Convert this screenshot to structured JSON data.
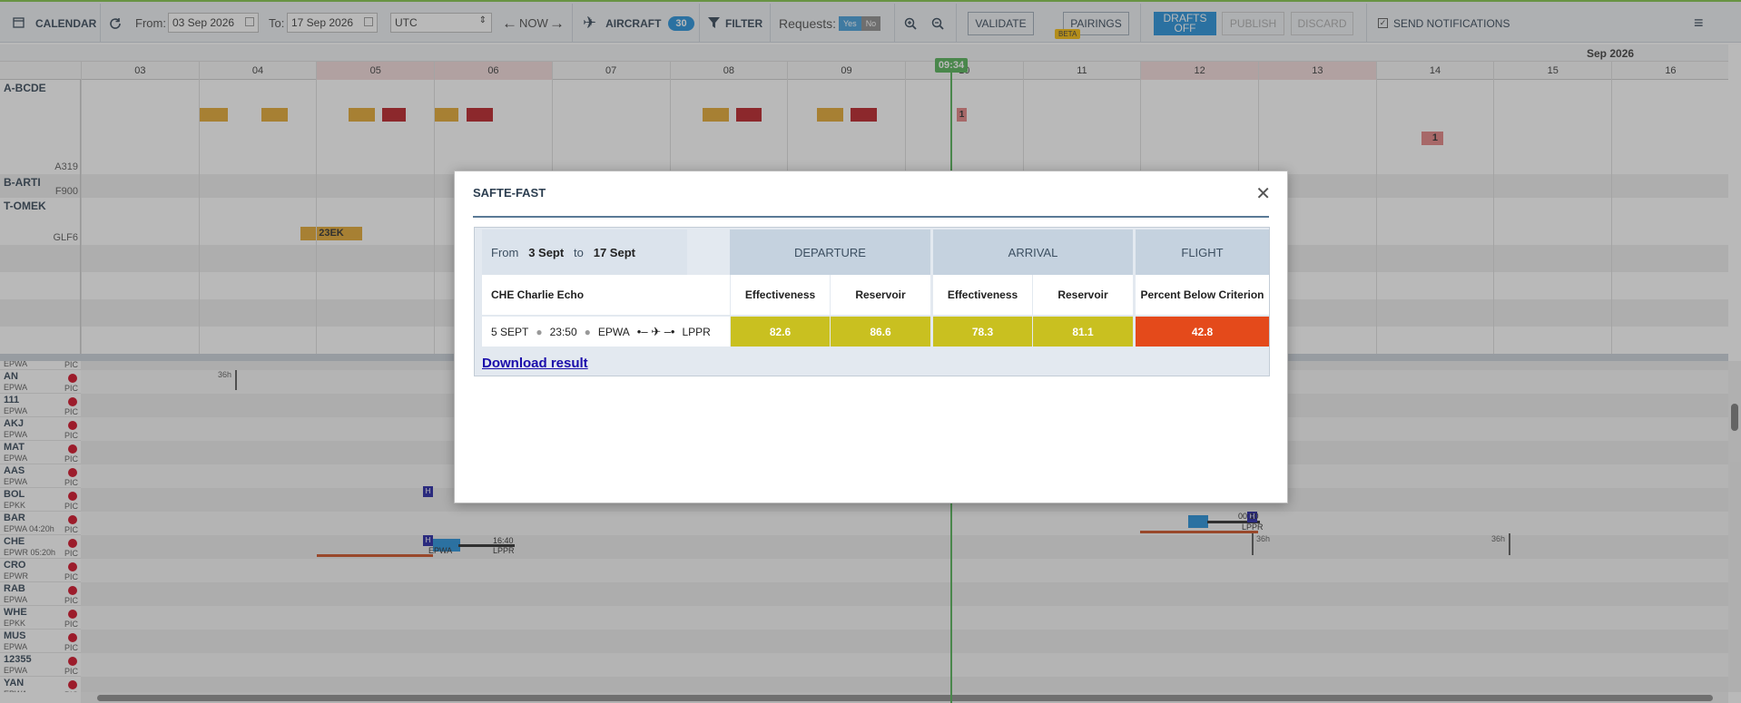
{
  "toolbar": {
    "calendar_label": "CALENDAR",
    "from_label": "From:",
    "from_value": "03 Sep 2026",
    "to_label": "To:",
    "to_value": "17 Sep 2026",
    "timezone": "UTC",
    "now_label": "NOW",
    "aircraft_label": "AIRCRAFT",
    "aircraft_count": "30",
    "filter_label": "FILTER",
    "requests_label": "Requests:",
    "requests_yes": "Yes",
    "requests_no": "No",
    "validate_label": "VALIDATE",
    "pairings_label": "PAIRINGS",
    "beta_label": "BETA",
    "drafts_label_1": "DRAFTS",
    "drafts_label_2": "OFF",
    "publish_label": "PUBLISH",
    "discard_label": "DISCARD",
    "send_notifications_label": "SEND NOTIFICATIONS"
  },
  "timeline": {
    "month_label": "Sep 2026",
    "days": [
      "03",
      "04",
      "05",
      "06",
      "07",
      "08",
      "09",
      "10",
      "11",
      "12",
      "13",
      "14",
      "15",
      "16"
    ],
    "now_time": "09:34"
  },
  "aircraft": [
    {
      "reg": "A-BCDE",
      "type": "A319"
    },
    {
      "reg": "B-ARTI",
      "type": "F900"
    },
    {
      "reg": "T-OMEK",
      "type": "GLF6"
    }
  ],
  "aircraft_blocks": {
    "b1_label": "1",
    "b2_label": "1",
    "b3_label": "23EK"
  },
  "crew": [
    {
      "code": "",
      "base": "EPWA",
      "role": "PIC"
    },
    {
      "code": "AN",
      "base": "EPWA",
      "role": "PIC"
    },
    {
      "code": "111",
      "base": "EPWA",
      "role": "PIC"
    },
    {
      "code": "AKJ",
      "base": "EPWA",
      "role": "PIC"
    },
    {
      "code": "MAT",
      "base": "EPWA",
      "role": "PIC"
    },
    {
      "code": "AAS",
      "base": "EPWA",
      "role": "PIC"
    },
    {
      "code": "BOL",
      "base": "EPKK",
      "role": "PIC"
    },
    {
      "code": "BAR",
      "base": "EPWA 04:20h",
      "role": "PIC"
    },
    {
      "code": "CHE",
      "base": "EPWR 05:20h",
      "role": "PIC"
    },
    {
      "code": "CRO",
      "base": "EPWR",
      "role": "PIC"
    },
    {
      "code": "RAB",
      "base": "EPWA",
      "role": "PIC"
    },
    {
      "code": "WHE",
      "base": "EPKK",
      "role": "PIC"
    },
    {
      "code": "MUS",
      "base": "EPWA",
      "role": "PIC"
    },
    {
      "code": "12355",
      "base": "EPWA",
      "role": "PIC"
    },
    {
      "code": "YAN",
      "base": "EPWA",
      "role": "PIC"
    }
  ],
  "gantt": {
    "rest_36h": "36h",
    "duty_marker": "H",
    "flight_time": "16:40",
    "flight_dep": "EPWA",
    "flight_arr": "LPPR",
    "bar_time": "00:10",
    "bar_arr": "LPPR"
  },
  "modal": {
    "title": "SAFTE-FAST",
    "from_word": "From",
    "from_date": "3 Sept",
    "to_word": "to",
    "to_date": "17 Sept",
    "departure_header": "DEPARTURE",
    "arrival_header": "ARRIVAL",
    "flight_header": "FLIGHT",
    "crew_name": "CHE Charlie Echo",
    "effectiveness_label": "Effectiveness",
    "reservoir_label": "Reservoir",
    "criterion_label": "Percent Below Criterion",
    "row_date": "5 SEPT",
    "row_time": "23:50",
    "row_dep": "EPWA",
    "row_arr": "LPPR",
    "dep_effectiveness": "82.6",
    "dep_reservoir": "86.6",
    "arr_effectiveness": "78.3",
    "arr_reservoir": "81.1",
    "flight_criterion": "42.8",
    "download_label": "Download result"
  },
  "colors": {
    "accent": "#1a8bd8",
    "value_yellow": "#c9c020",
    "value_orange": "#e44a1b",
    "now_green": "#4caf50"
  }
}
